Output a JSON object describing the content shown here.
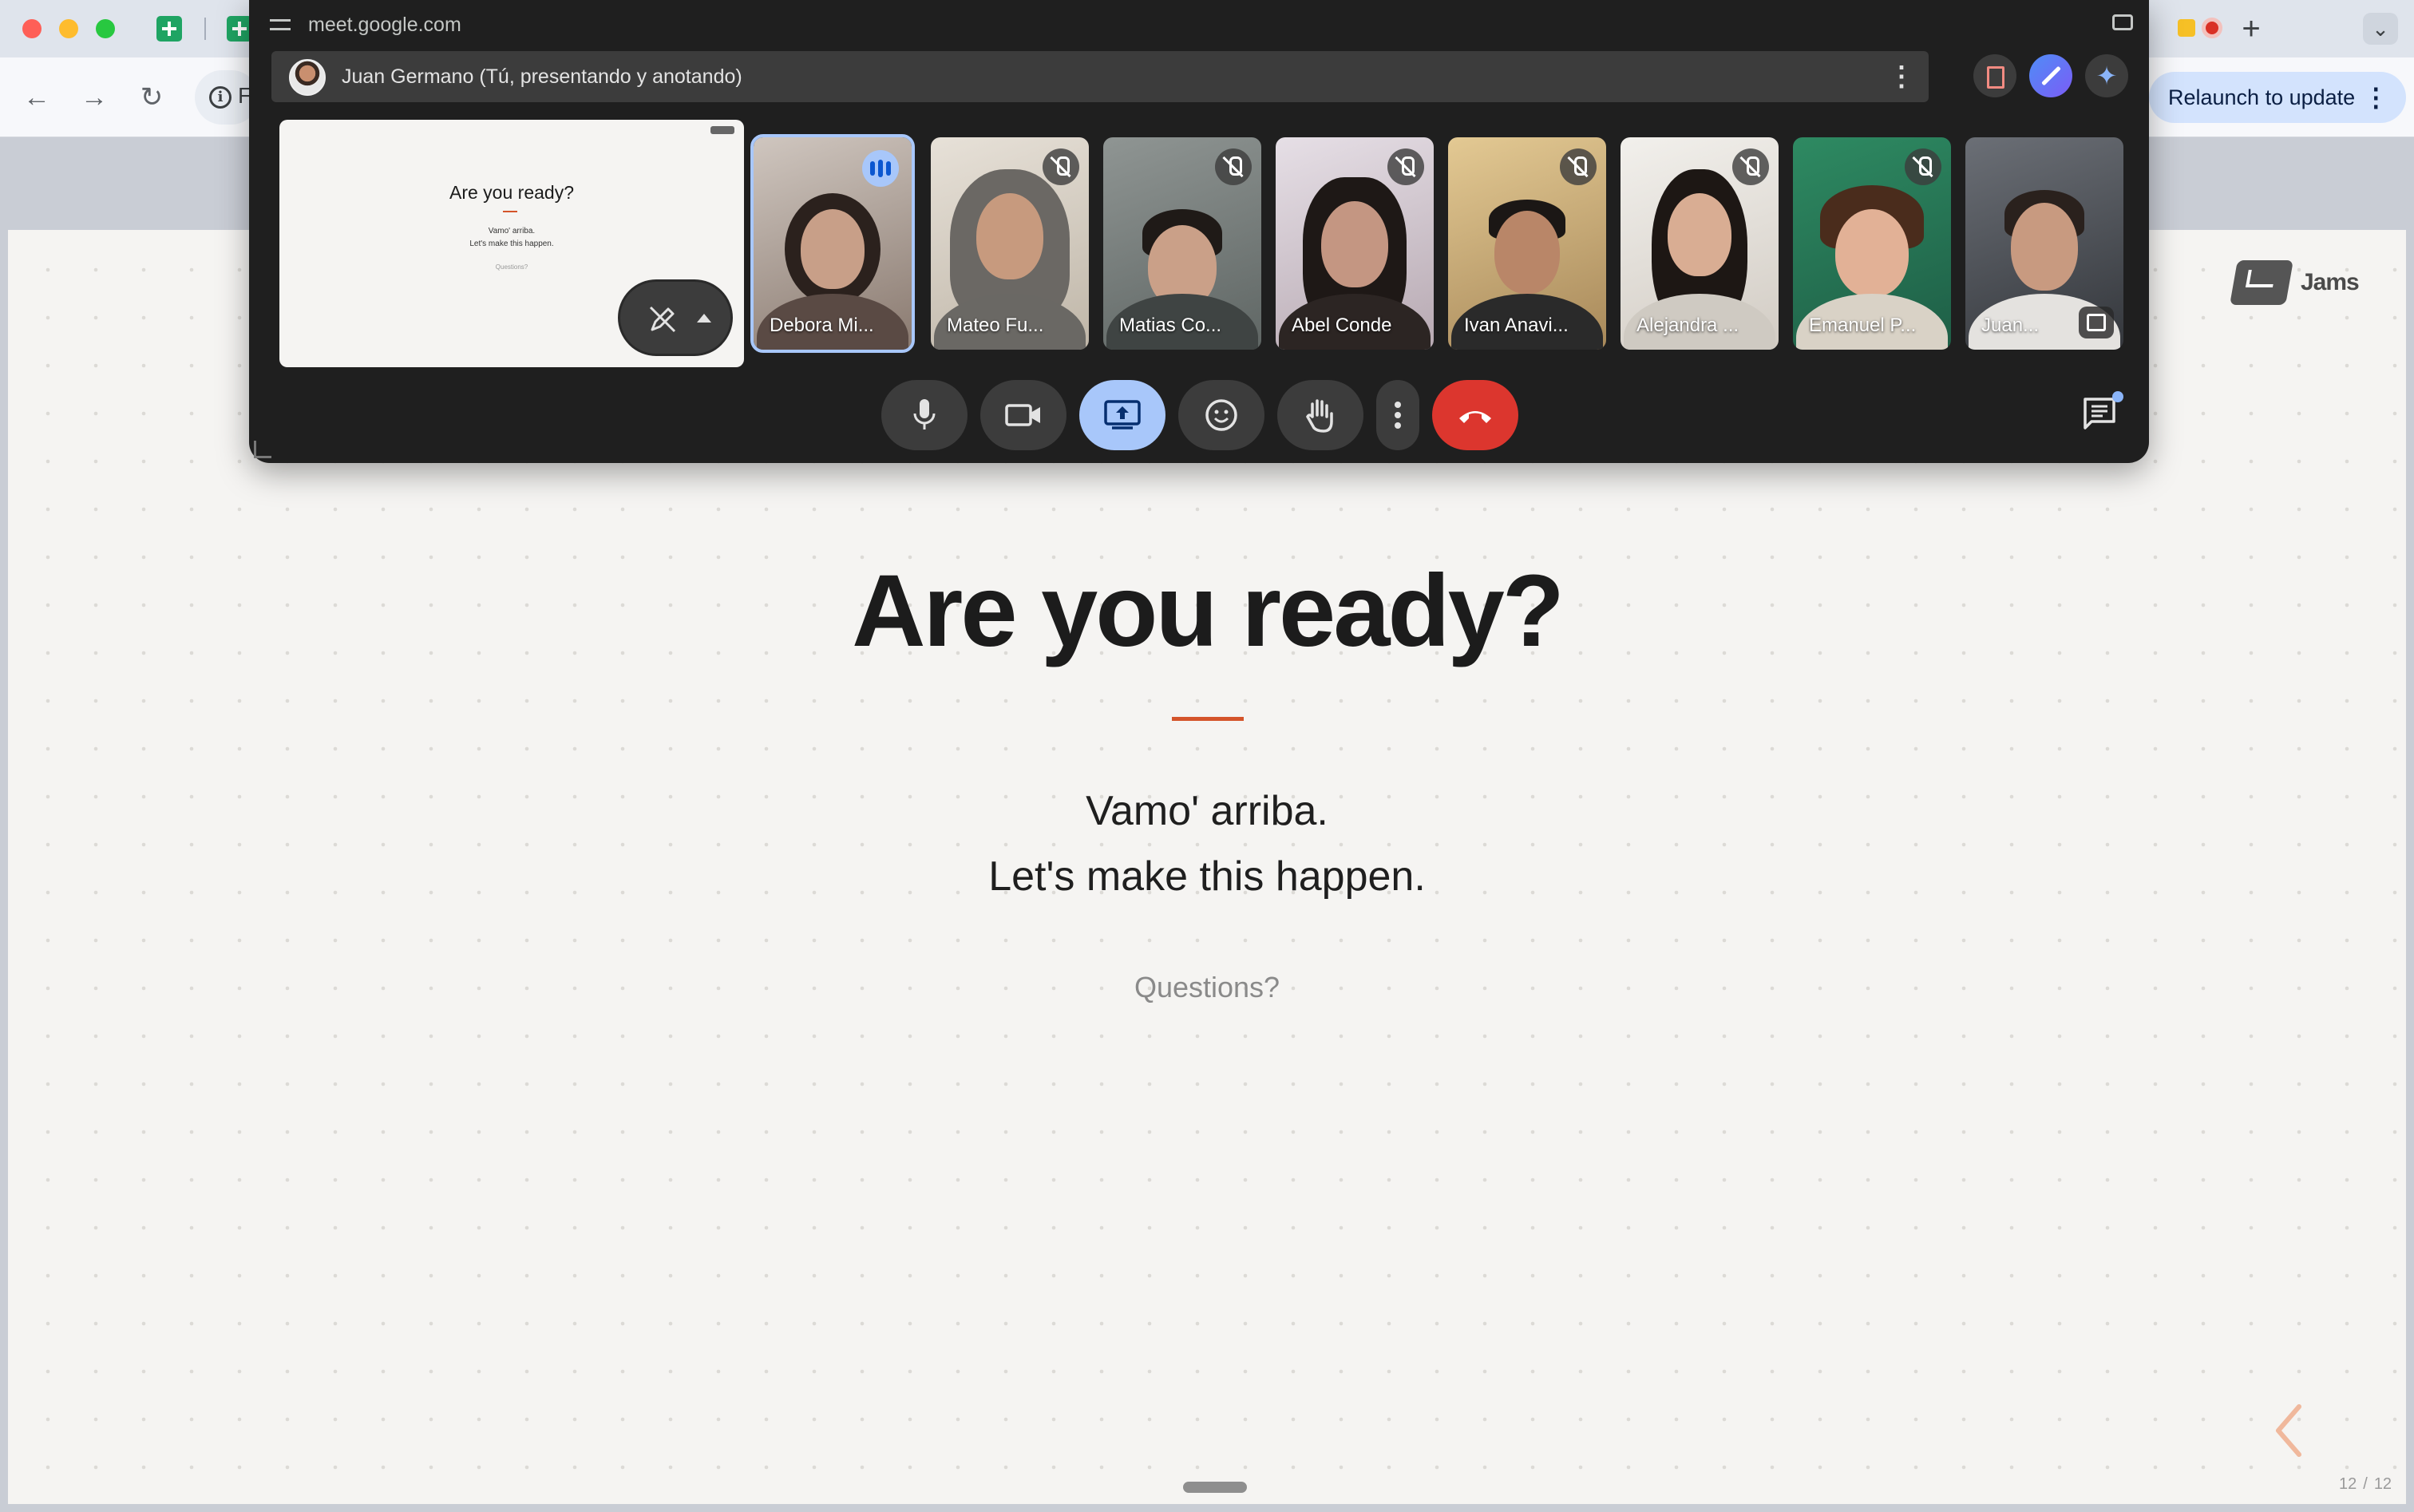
{
  "browser": {
    "relaunch_label": "Relaunch to update",
    "omnibox_partial": "F"
  },
  "pip": {
    "url": "meet.google.com",
    "presenter_label": "Juan Germano (Tú, presentando y anotando)",
    "participants": [
      {
        "name": "Debora Mi...",
        "status": "speaking"
      },
      {
        "name": "Mateo Fu...",
        "status": "muted"
      },
      {
        "name": "Matias Co...",
        "status": "muted"
      },
      {
        "name": "Abel Conde",
        "status": "muted"
      },
      {
        "name": "Ivan Anavi...",
        "status": "muted"
      },
      {
        "name": "Alejandra ...",
        "status": "muted"
      },
      {
        "name": "Emanuel P...",
        "status": "muted"
      },
      {
        "name": "Juan...",
        "status": "self"
      }
    ],
    "controls": [
      "microphone",
      "camera",
      "present-screen",
      "reactions",
      "raise-hand",
      "more-options",
      "leave-call"
    ],
    "colors": {
      "present_active": "#a8c7fa",
      "hangup": "#dc362e"
    }
  },
  "slide": {
    "title": "Are you ready?",
    "line1": "Vamo' arriba.",
    "line2": "Let's make this happen.",
    "questions": "Questions?",
    "brand": "Jams",
    "page_current": "12",
    "page_sep": "/",
    "page_total": "12",
    "accent_color": "#d4542a"
  }
}
